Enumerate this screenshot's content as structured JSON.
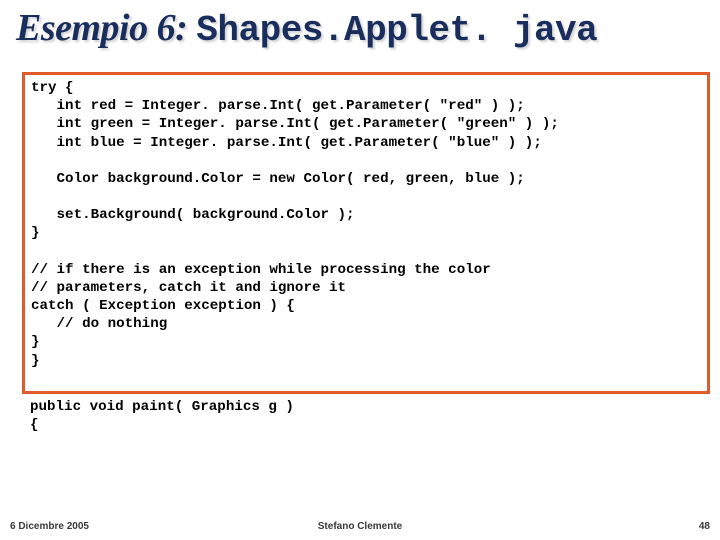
{
  "title": {
    "prefix": "Esempio 6: ",
    "filename": "Shapes.Applet. java"
  },
  "code_block": "try {\n   int red = Integer. parse.Int( get.Parameter( \"red\" ) );\n   int green = Integer. parse.Int( get.Parameter( \"green\" ) );\n   int blue = Integer. parse.Int( get.Parameter( \"blue\" ) );\n\n   Color background.Color = new Color( red, green, blue );\n\n   set.Background( background.Color );\n}\n\n// if there is an exception while processing the color\n// parameters, catch it and ignore it\ncatch ( Exception exception ) {\n   // do nothing\n}\n}",
  "code_below": "public void paint( Graphics g )\n{",
  "footer": {
    "date": "6 Dicembre 2005",
    "author": "Stefano Clemente",
    "page": "48"
  }
}
